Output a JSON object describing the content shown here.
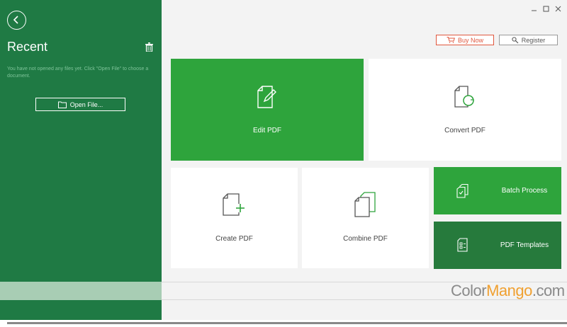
{
  "sidebar": {
    "title": "Recent",
    "empty_message": "You have not opened any files yet. Click \"Open File\" to choose a document.",
    "open_file_label": "Open File..."
  },
  "header": {
    "buy_label": "Buy Now",
    "register_label": "Register"
  },
  "tiles": {
    "edit": "Edit PDF",
    "convert": "Convert PDF",
    "create": "Create PDF",
    "combine": "Combine PDF",
    "batch": "Batch Process",
    "templates": "PDF Templates"
  },
  "watermark": {
    "part1": "Color",
    "part2": "Mango",
    "part3": ".com"
  },
  "colors": {
    "sidebar": "#1f7a44",
    "tile_green": "#2ea43c",
    "tile_dark": "#267a3c",
    "buy_accent": "#e0573e"
  }
}
